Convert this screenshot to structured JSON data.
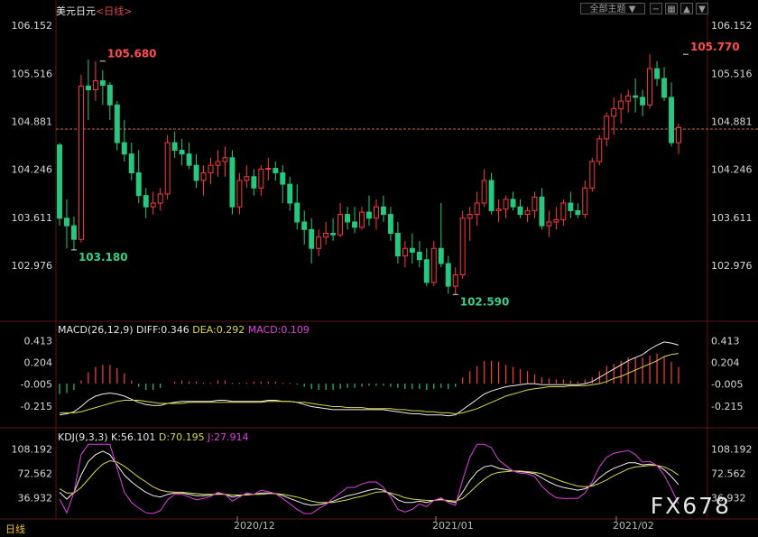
{
  "header": {
    "symbol": "美元日元",
    "period": "<日线>",
    "theme_button": "全部主题 ▼",
    "icons": [
      "minus-icon",
      "grid-icon",
      "up-arrow-icon",
      "down-arrow-icon"
    ]
  },
  "macd": {
    "label": "MACD(26,12,9)",
    "diff": "DIFF:0.346",
    "dea": "DEA:0.292",
    "macd": "MACD:0.109"
  },
  "kdj": {
    "label": "KDJ(9,3,3)",
    "k": "K:56.101",
    "d": "D:70.195",
    "j": "J:27.914"
  },
  "footer": {
    "period_tab": "日线",
    "dates": [
      "2020/12",
      "2021/01",
      "2021/02"
    ],
    "watermark": "FX678"
  },
  "colors": {
    "up": "#ff3b3b",
    "down": "#27c77f",
    "axis_text": "#d8d8d8",
    "grid": "#5a1616",
    "dea": "#d8d84a",
    "macd": "#e040e0",
    "last_price_line": "#d36a3a"
  },
  "chart_data": [
    {
      "type": "candlestick",
      "title": "美元日元 <日线>",
      "y_ticks": [
        "106.152",
        "105.516",
        "104.881",
        "104.246",
        "103.611",
        "102.976"
      ],
      "ylim": [
        102.45,
        106.25
      ],
      "x_tick_labels": [
        "2020/12",
        "2021/01",
        "2021/02"
      ],
      "annotations": [
        {
          "label": "105.680",
          "index": 6,
          "value": 105.68
        },
        {
          "label": "103.180",
          "index": 2,
          "value": 103.18
        },
        {
          "label": "102.590",
          "index": 55,
          "value": 102.59
        },
        {
          "label": "105.770",
          "index": 87,
          "value": 105.77
        }
      ],
      "reference_line": 104.78,
      "ohlc": [
        [
          104.57,
          104.6,
          103.5,
          103.6
        ],
        [
          103.6,
          103.85,
          103.2,
          103.5
        ],
        [
          103.5,
          103.62,
          103.18,
          103.32
        ],
        [
          103.32,
          105.5,
          103.28,
          105.35
        ],
        [
          105.35,
          105.7,
          104.9,
          105.3
        ],
        [
          105.3,
          105.68,
          105.15,
          105.42
        ],
        [
          105.42,
          105.56,
          105.1,
          105.36
        ],
        [
          105.36,
          105.4,
          104.9,
          105.1
        ],
        [
          105.1,
          105.15,
          104.5,
          104.6
        ],
        [
          104.6,
          104.9,
          104.35,
          104.45
        ],
        [
          104.45,
          104.6,
          104.1,
          104.2
        ],
        [
          104.2,
          104.5,
          103.8,
          103.9
        ],
        [
          103.9,
          104.0,
          103.6,
          103.75
        ],
        [
          103.75,
          103.95,
          103.65,
          103.8
        ],
        [
          103.8,
          104.0,
          103.7,
          103.92
        ],
        [
          103.92,
          104.7,
          103.85,
          104.6
        ],
        [
          104.6,
          104.75,
          104.4,
          104.5
        ],
        [
          104.5,
          104.65,
          104.3,
          104.45
        ],
        [
          104.45,
          104.6,
          104.25,
          104.3
        ],
        [
          104.3,
          104.45,
          104.0,
          104.1
        ],
        [
          104.1,
          104.3,
          103.9,
          104.2
        ],
        [
          104.2,
          104.4,
          104.05,
          104.3
        ],
        [
          104.3,
          104.5,
          104.15,
          104.35
        ],
        [
          104.35,
          104.55,
          104.15,
          104.4
        ],
        [
          104.4,
          104.5,
          103.65,
          103.75
        ],
        [
          103.75,
          104.2,
          103.65,
          104.1
        ],
        [
          104.1,
          104.3,
          104.0,
          104.15
        ],
        [
          104.15,
          104.25,
          103.9,
          104.0
        ],
        [
          104.0,
          104.3,
          103.9,
          104.25
        ],
        [
          104.25,
          104.4,
          104.1,
          104.26
        ],
        [
          104.26,
          104.35,
          104.1,
          104.2
        ],
        [
          104.2,
          104.3,
          103.8,
          104.05
        ],
        [
          104.05,
          104.15,
          103.7,
          103.8
        ],
        [
          103.8,
          104.05,
          103.45,
          103.55
        ],
        [
          103.55,
          103.7,
          103.25,
          103.45
        ],
        [
          103.45,
          103.6,
          103.0,
          103.2
        ],
        [
          103.2,
          103.45,
          103.1,
          103.35
        ],
        [
          103.35,
          103.55,
          103.25,
          103.4
        ],
        [
          103.4,
          103.6,
          103.3,
          103.38
        ],
        [
          103.38,
          103.8,
          103.35,
          103.65
        ],
        [
          103.65,
          103.75,
          103.45,
          103.55
        ],
        [
          103.55,
          103.75,
          103.4,
          103.48
        ],
        [
          103.48,
          103.75,
          103.45,
          103.68
        ],
        [
          103.68,
          103.9,
          103.5,
          103.6
        ],
        [
          103.6,
          103.85,
          103.45,
          103.75
        ],
        [
          103.75,
          103.9,
          103.55,
          103.65
        ],
        [
          103.65,
          103.75,
          103.3,
          103.4
        ],
        [
          103.4,
          103.55,
          103.0,
          103.1
        ],
        [
          103.1,
          103.3,
          102.95,
          103.2
        ],
        [
          103.2,
          103.4,
          103.0,
          103.15
        ],
        [
          103.15,
          103.3,
          102.95,
          103.05
        ],
        [
          103.05,
          103.2,
          102.7,
          102.75
        ],
        [
          102.75,
          103.3,
          102.7,
          103.2
        ],
        [
          103.2,
          103.8,
          102.95,
          103.0
        ],
        [
          103.0,
          103.1,
          102.6,
          102.7
        ],
        [
          102.7,
          102.95,
          102.59,
          102.85
        ],
        [
          102.85,
          103.7,
          102.8,
          103.6
        ],
        [
          103.6,
          103.75,
          103.3,
          103.65
        ],
        [
          103.65,
          103.95,
          103.5,
          103.8
        ],
        [
          103.8,
          104.25,
          103.75,
          104.1
        ],
        [
          104.1,
          104.2,
          103.65,
          103.7
        ],
        [
          103.7,
          103.85,
          103.55,
          103.72
        ],
        [
          103.72,
          103.9,
          103.6,
          103.85
        ],
        [
          103.85,
          103.95,
          103.7,
          103.75
        ],
        [
          103.75,
          103.85,
          103.6,
          103.65
        ],
        [
          103.65,
          103.75,
          103.55,
          103.7
        ],
        [
          103.7,
          103.95,
          103.6,
          103.88
        ],
        [
          103.88,
          104.0,
          103.45,
          103.5
        ],
        [
          103.5,
          103.7,
          103.35,
          103.55
        ],
        [
          103.55,
          103.75,
          103.45,
          103.58
        ],
        [
          103.58,
          103.85,
          103.5,
          103.8
        ],
        [
          103.8,
          103.95,
          103.6,
          103.7
        ],
        [
          103.7,
          103.8,
          103.6,
          103.65
        ],
        [
          103.65,
          104.1,
          103.6,
          104.0
        ],
        [
          104.0,
          104.4,
          103.95,
          104.35
        ],
        [
          104.35,
          104.7,
          104.3,
          104.65
        ],
        [
          104.65,
          105.0,
          104.55,
          104.95
        ],
        [
          104.95,
          105.2,
          104.7,
          105.05
        ],
        [
          105.05,
          105.25,
          104.85,
          105.15
        ],
        [
          105.15,
          105.3,
          105.0,
          105.22
        ],
        [
          105.22,
          105.45,
          105.0,
          105.2
        ],
        [
          105.2,
          105.3,
          104.95,
          105.1
        ],
        [
          105.1,
          105.77,
          105.05,
          105.58
        ],
        [
          105.58,
          105.68,
          105.35,
          105.45
        ],
        [
          105.45,
          105.6,
          105.15,
          105.2
        ],
        [
          105.2,
          105.4,
          104.55,
          104.6
        ],
        [
          104.6,
          104.85,
          104.45,
          104.8
        ]
      ]
    },
    {
      "type": "line",
      "title": "MACD(26,12,9)",
      "y_ticks": [
        "0.413",
        "0.204",
        "-0.005",
        "-0.215"
      ],
      "ylim": [
        -0.32,
        0.46
      ],
      "series": [
        {
          "name": "DIFF",
          "values": [
            -0.3,
            -0.29,
            -0.27,
            -0.22,
            -0.16,
            -0.12,
            -0.1,
            -0.09,
            -0.1,
            -0.12,
            -0.15,
            -0.18,
            -0.2,
            -0.21,
            -0.21,
            -0.19,
            -0.18,
            -0.17,
            -0.17,
            -0.17,
            -0.17,
            -0.17,
            -0.16,
            -0.16,
            -0.17,
            -0.17,
            -0.17,
            -0.17,
            -0.17,
            -0.16,
            -0.16,
            -0.17,
            -0.17,
            -0.18,
            -0.2,
            -0.22,
            -0.23,
            -0.24,
            -0.25,
            -0.25,
            -0.25,
            -0.25,
            -0.25,
            -0.25,
            -0.25,
            -0.25,
            -0.26,
            -0.27,
            -0.28,
            -0.29,
            -0.29,
            -0.3,
            -0.3,
            -0.3,
            -0.31,
            -0.3,
            -0.25,
            -0.2,
            -0.15,
            -0.1,
            -0.07,
            -0.05,
            -0.03,
            -0.02,
            -0.01,
            0.0,
            0.0,
            -0.01,
            -0.01,
            -0.01,
            -0.01,
            -0.01,
            -0.01,
            0.0,
            0.02,
            0.06,
            0.1,
            0.14,
            0.18,
            0.22,
            0.25,
            0.28,
            0.33,
            0.37,
            0.4,
            0.39,
            0.37
          ]
        },
        {
          "name": "DEA",
          "values": [
            -0.28,
            -0.28,
            -0.28,
            -0.27,
            -0.25,
            -0.23,
            -0.21,
            -0.19,
            -0.17,
            -0.16,
            -0.16,
            -0.16,
            -0.17,
            -0.18,
            -0.19,
            -0.19,
            -0.19,
            -0.19,
            -0.18,
            -0.18,
            -0.18,
            -0.18,
            -0.18,
            -0.18,
            -0.18,
            -0.18,
            -0.18,
            -0.18,
            -0.18,
            -0.17,
            -0.17,
            -0.17,
            -0.17,
            -0.18,
            -0.18,
            -0.19,
            -0.2,
            -0.21,
            -0.22,
            -0.22,
            -0.23,
            -0.23,
            -0.23,
            -0.24,
            -0.24,
            -0.24,
            -0.24,
            -0.25,
            -0.25,
            -0.26,
            -0.26,
            -0.27,
            -0.27,
            -0.28,
            -0.28,
            -0.29,
            -0.28,
            -0.26,
            -0.24,
            -0.21,
            -0.18,
            -0.15,
            -0.12,
            -0.1,
            -0.08,
            -0.06,
            -0.05,
            -0.04,
            -0.03,
            -0.03,
            -0.03,
            -0.02,
            -0.02,
            -0.02,
            -0.01,
            0.0,
            0.02,
            0.05,
            0.07,
            0.1,
            0.13,
            0.16,
            0.19,
            0.22,
            0.26,
            0.28,
            0.29
          ]
        },
        {
          "name": "MACD",
          "values": [
            -0.1,
            -0.09,
            -0.06,
            0.03,
            0.11,
            0.16,
            0.18,
            0.18,
            0.15,
            0.1,
            0.03,
            -0.03,
            -0.06,
            -0.06,
            -0.04,
            0.0,
            0.02,
            0.03,
            0.02,
            0.02,
            0.01,
            0.01,
            0.03,
            0.03,
            0.01,
            0.01,
            0.01,
            0.02,
            0.02,
            0.02,
            0.02,
            0.01,
            0.01,
            -0.01,
            -0.03,
            -0.05,
            -0.06,
            -0.06,
            -0.06,
            -0.05,
            -0.04,
            -0.04,
            -0.03,
            -0.02,
            -0.02,
            -0.02,
            -0.03,
            -0.04,
            -0.05,
            -0.05,
            -0.05,
            -0.06,
            -0.05,
            -0.04,
            -0.05,
            -0.03,
            0.06,
            0.12,
            0.17,
            0.22,
            0.22,
            0.21,
            0.18,
            0.16,
            0.14,
            0.12,
            0.09,
            0.06,
            0.05,
            0.04,
            0.04,
            0.03,
            0.02,
            0.04,
            0.06,
            0.12,
            0.17,
            0.19,
            0.22,
            0.25,
            0.25,
            0.25,
            0.27,
            0.29,
            0.26,
            0.21,
            0.16
          ]
        }
      ]
    },
    {
      "type": "line",
      "title": "KDJ(9,3,3)",
      "y_ticks": [
        "108.192",
        "72.562",
        "36.932"
      ],
      "ylim": [
        10,
        118
      ],
      "series": [
        {
          "name": "K",
          "values": [
            45,
            35,
            45,
            70,
            90,
            100,
            105,
            100,
            85,
            70,
            60,
            52,
            45,
            40,
            38,
            42,
            44,
            44,
            42,
            40,
            40,
            41,
            43,
            42,
            38,
            40,
            42,
            42,
            44,
            44,
            43,
            40,
            36,
            32,
            28,
            26,
            27,
            29,
            32,
            36,
            40,
            42,
            45,
            48,
            50,
            48,
            42,
            34,
            30,
            30,
            32,
            30,
            33,
            35,
            32,
            30,
            45,
            62,
            75,
            82,
            84,
            80,
            78,
            76,
            75,
            74,
            72,
            66,
            60,
            55,
            52,
            50,
            48,
            50,
            56,
            66,
            74,
            80,
            84,
            88,
            88,
            85,
            86,
            84,
            78,
            68,
            56
          ]
        },
        {
          "name": "D",
          "values": [
            50,
            44,
            44,
            52,
            64,
            76,
            86,
            91,
            89,
            83,
            75,
            67,
            60,
            53,
            48,
            46,
            45,
            45,
            44,
            43,
            42,
            42,
            42,
            42,
            41,
            41,
            41,
            42,
            42,
            43,
            43,
            42,
            40,
            38,
            35,
            32,
            30,
            30,
            30,
            32,
            34,
            37,
            39,
            42,
            45,
            46,
            44,
            41,
            37,
            35,
            34,
            33,
            33,
            34,
            33,
            32,
            36,
            45,
            55,
            64,
            71,
            74,
            75,
            76,
            76,
            75,
            74,
            72,
            68,
            64,
            60,
            57,
            54,
            53,
            54,
            58,
            63,
            69,
            74,
            79,
            82,
            83,
            84,
            84,
            82,
            77,
            70
          ]
        },
        {
          "name": "J",
          "values": [
            35,
            15,
            45,
            100,
            115,
            115,
            115,
            115,
            80,
            45,
            30,
            22,
            15,
            14,
            18,
            34,
            42,
            42,
            38,
            34,
            36,
            39,
            45,
            42,
            32,
            38,
            44,
            42,
            48,
            46,
            43,
            36,
            28,
            20,
            14,
            14,
            21,
            27,
            36,
            44,
            52,
            52,
            57,
            60,
            60,
            52,
            38,
            20,
            16,
            20,
            28,
            24,
            33,
            37,
            30,
            26,
            63,
            96,
            115,
            115,
            110,
            92,
            84,
            76,
            73,
            72,
            68,
            54,
            44,
            37,
            36,
            36,
            36,
            44,
            60,
            82,
            96,
            102,
            104,
            106,
            100,
            89,
            90,
            84,
            70,
            50,
            28
          ]
        }
      ]
    }
  ]
}
